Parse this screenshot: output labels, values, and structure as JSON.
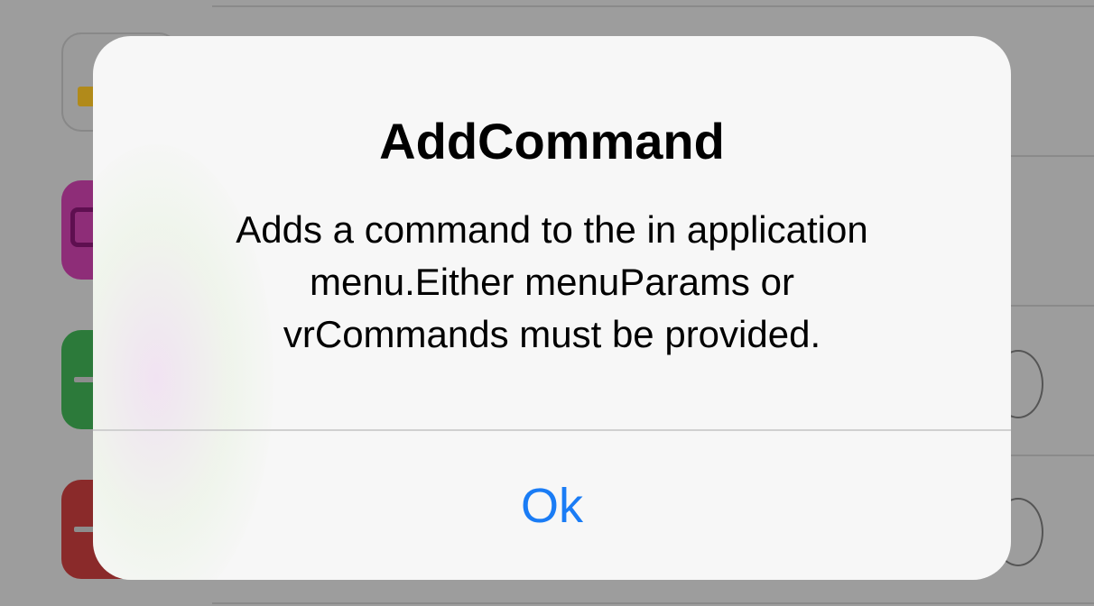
{
  "alert": {
    "title": "AddCommand",
    "message": "Adds a command to the in application\nmenu.Either menuParams or\nvrCommands must be provided.",
    "ok_label": "Ok"
  },
  "colors": {
    "accent": "#1a7cf5",
    "overlay_background": "#9d9d9d",
    "alert_background": "#f7f7f7"
  },
  "background_list": {
    "icons": [
      "document-icon",
      "hexagon-app-icon",
      "green-minus-icon",
      "red-minus-icon"
    ]
  }
}
